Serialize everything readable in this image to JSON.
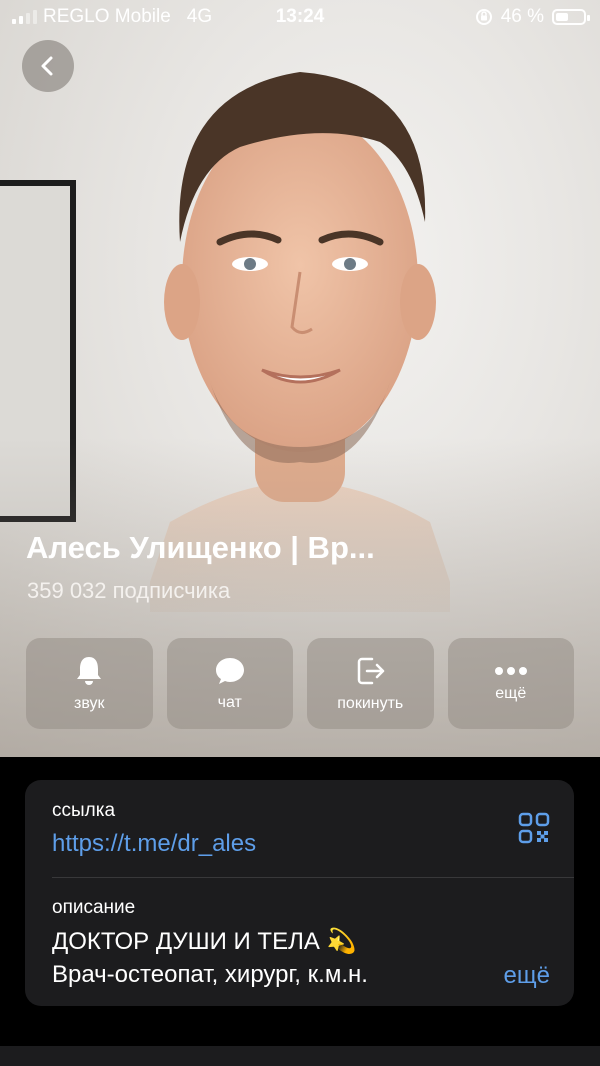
{
  "status": {
    "carrier": "REGLO Mobile",
    "network": "4G",
    "time": "13:24",
    "battery": "46 %",
    "battery_level": 0.46
  },
  "profile": {
    "name": "Алесь Улищенко | Вр...",
    "subscribers": "359 032 подписчика"
  },
  "actions": [
    {
      "icon": "bell-icon",
      "label": "звук"
    },
    {
      "icon": "chat-icon",
      "label": "чат"
    },
    {
      "icon": "leave-icon",
      "label": "покинуть"
    },
    {
      "icon": "more-dots-icon",
      "label": "ещё"
    }
  ],
  "info": {
    "link_label": "ссылка",
    "link": "https://t.me/dr_ales",
    "desc_label": "описание",
    "desc_line1": "ДОКТОР ДУШИ И ТЕЛА 💫",
    "desc_line2": "Врач-остеопат, хирург, к.м.н.",
    "more": "ещё"
  },
  "colors": {
    "accent": "#5e9ee9",
    "card": "#1c1c1e"
  }
}
